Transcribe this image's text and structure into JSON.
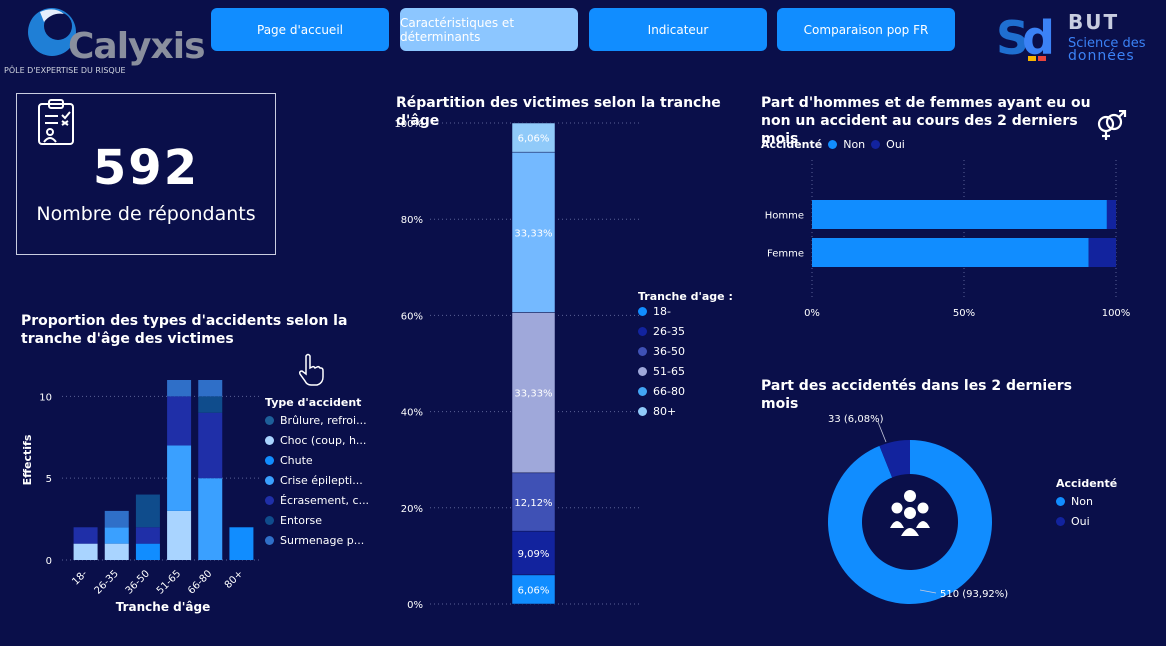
{
  "header": {
    "calyxis_brand": "Calyxis",
    "calyxis_tagline": "PÔLE D'EXPERTISE DU RISQUE",
    "but_title": "BUT",
    "but_sub1": "Science des",
    "but_sub2": "données",
    "nav": [
      {
        "label": "Page d'accueil",
        "active": false
      },
      {
        "label": "Caractéristiques et déterminants",
        "active": true
      },
      {
        "label": "Indicateur",
        "active": false
      },
      {
        "label": "Comparaison pop FR",
        "active": false
      }
    ]
  },
  "kpi": {
    "value": "592",
    "label": "Nombre de répondants",
    "icon": "clipboard-icon"
  },
  "colors": {
    "background": "#0a0f4a",
    "accent": "#118dff",
    "dark_blue": "#12239e",
    "age": {
      "18-": "#118dff",
      "26-35": "#12239e",
      "36-50": "#3f51b5",
      "51-65": "#9fa8da",
      "66-80": "#42a5f5",
      "80+": "#90caf9"
    }
  },
  "chart_data": [
    {
      "id": "accident_types_by_age",
      "type": "bar",
      "title": "Proportion des types d'accidents selon la tranche d'âge des victimes",
      "xlabel": "Tranche d'âge",
      "ylabel": "Effectifs",
      "categories": [
        "18-",
        "26-35",
        "36-50",
        "51-65",
        "66-80",
        "80+"
      ],
      "yticks": [
        0,
        5,
        10
      ],
      "ylim": [
        0,
        11
      ],
      "legend_title": "Type d'accident",
      "series": [
        {
          "name": "Brûlure, refroi...",
          "color": "#1d5f9a",
          "values": [
            0,
            0,
            0,
            0,
            0,
            0
          ]
        },
        {
          "name": "Choc (coup, h...",
          "color": "#a9d4ff",
          "values": [
            1,
            1,
            0,
            3,
            0,
            0
          ]
        },
        {
          "name": "Chute",
          "color": "#118dff",
          "values": [
            0,
            0,
            1,
            0,
            0,
            2
          ]
        },
        {
          "name": "Crise épilepti...",
          "color": "#3aa0ff",
          "values": [
            0,
            1,
            0,
            4,
            5,
            0
          ]
        },
        {
          "name": "Écrasement, c...",
          "color": "#1f2fa8",
          "values": [
            1,
            0,
            1,
            3,
            4,
            0
          ]
        },
        {
          "name": "Entorse",
          "color": "#0f4c8c",
          "values": [
            0,
            0,
            2,
            0,
            1,
            0
          ]
        },
        {
          "name": "Surmenage p...",
          "color": "#2f6fc8",
          "values": [
            0,
            1,
            0,
            1,
            1,
            0
          ]
        }
      ]
    },
    {
      "id": "victims_by_age",
      "type": "bar",
      "title": "Répartition des victimes selon la tranche d'âge",
      "yticks": [
        "0%",
        "20%",
        "40%",
        "60%",
        "80%",
        "100%"
      ],
      "legend_title": "Tranche d'age :",
      "segments": [
        {
          "name": "18-",
          "value": 6.06,
          "label": "6,06%",
          "color": "#118dff"
        },
        {
          "name": "26-35",
          "value": 9.09,
          "label": "9,09%",
          "color": "#12239e"
        },
        {
          "name": "36-50",
          "value": 12.12,
          "label": "12,12%",
          "color": "#3f51b5"
        },
        {
          "name": "51-65",
          "value": 33.33,
          "label": "33,33%",
          "color": "#9fa8da"
        },
        {
          "name": "66-80",
          "value": 33.33,
          "label": "33,33%",
          "color": "#74b9ff"
        },
        {
          "name": "80+",
          "value": 6.06,
          "label": "6,06%",
          "color": "#90caf9"
        }
      ],
      "legend_colors": [
        "#118dff",
        "#12239e",
        "#3f51b5",
        "#9fa8da",
        "#42a5f5",
        "#90caf9"
      ]
    },
    {
      "id": "gender_accident",
      "type": "bar",
      "title": "Part d'hommes et de femmes ayant eu ou non un accident au cours des 2 derniers mois",
      "legend_title": "Accidenté",
      "categories": [
        "Homme",
        "Femme"
      ],
      "xticks": [
        "0%",
        "50%",
        "100%"
      ],
      "series": [
        {
          "name": "Non",
          "color": "#118dff",
          "values": [
            97,
            91
          ]
        },
        {
          "name": "Oui",
          "color": "#12239e",
          "values": [
            3,
            9
          ]
        }
      ]
    },
    {
      "id": "accident_share",
      "type": "pie",
      "title": "Part des accidentés dans les 2 derniers mois",
      "legend_title": "Accidenté",
      "slices": [
        {
          "name": "Non",
          "value": 510,
          "pct": 93.92,
          "label": "510 (93,92%)",
          "color": "#118dff"
        },
        {
          "name": "Oui",
          "value": 33,
          "pct": 6.08,
          "label": "33 (6,08%)",
          "color": "#12239e"
        }
      ]
    }
  ]
}
